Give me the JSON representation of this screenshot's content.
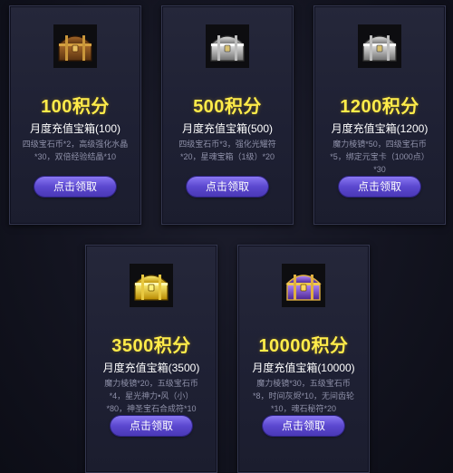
{
  "cards": [
    {
      "chest_icon": "wooden-chest-icon",
      "points": "100积分",
      "name": "月度充值宝箱(100)",
      "desc": [
        "四级宝石币*2，高级强化水晶",
        "*30，双倍经验结晶*10"
      ],
      "button": "点击领取"
    },
    {
      "chest_icon": "silver-chest-icon",
      "points": "500积分",
      "name": "月度充值宝箱(500)",
      "desc": [
        "四级宝石币*3，强化光耀符",
        "*20，星魂宝箱（1级）*20"
      ],
      "button": "点击领取"
    },
    {
      "chest_icon": "silver-chest-icon",
      "points": "1200积分",
      "name": "月度充值宝箱(1200)",
      "desc": [
        "魔力棱镜*50，四级宝石币",
        "*5，绑定元宝卡（1000点）",
        "*30"
      ],
      "button": "点击领取"
    },
    {
      "chest_icon": "gold-chest-icon",
      "points": "3500积分",
      "name": "月度充值宝箱(3500)",
      "desc": [
        "魔力棱镜*20，五级宝石币",
        "*4，星光神力•风（小）",
        "*80，神圣宝石合成符*10"
      ],
      "button": "点击领取"
    },
    {
      "chest_icon": "purple-chest-icon",
      "points": "10000积分",
      "name": "月度充值宝箱(10000)",
      "desc": [
        "魔力棱镜*30，五级宝石币",
        "*8，时间灰烬*10，无间齿轮",
        "*10，魂石秘符*20"
      ],
      "button": "点击领取"
    }
  ]
}
